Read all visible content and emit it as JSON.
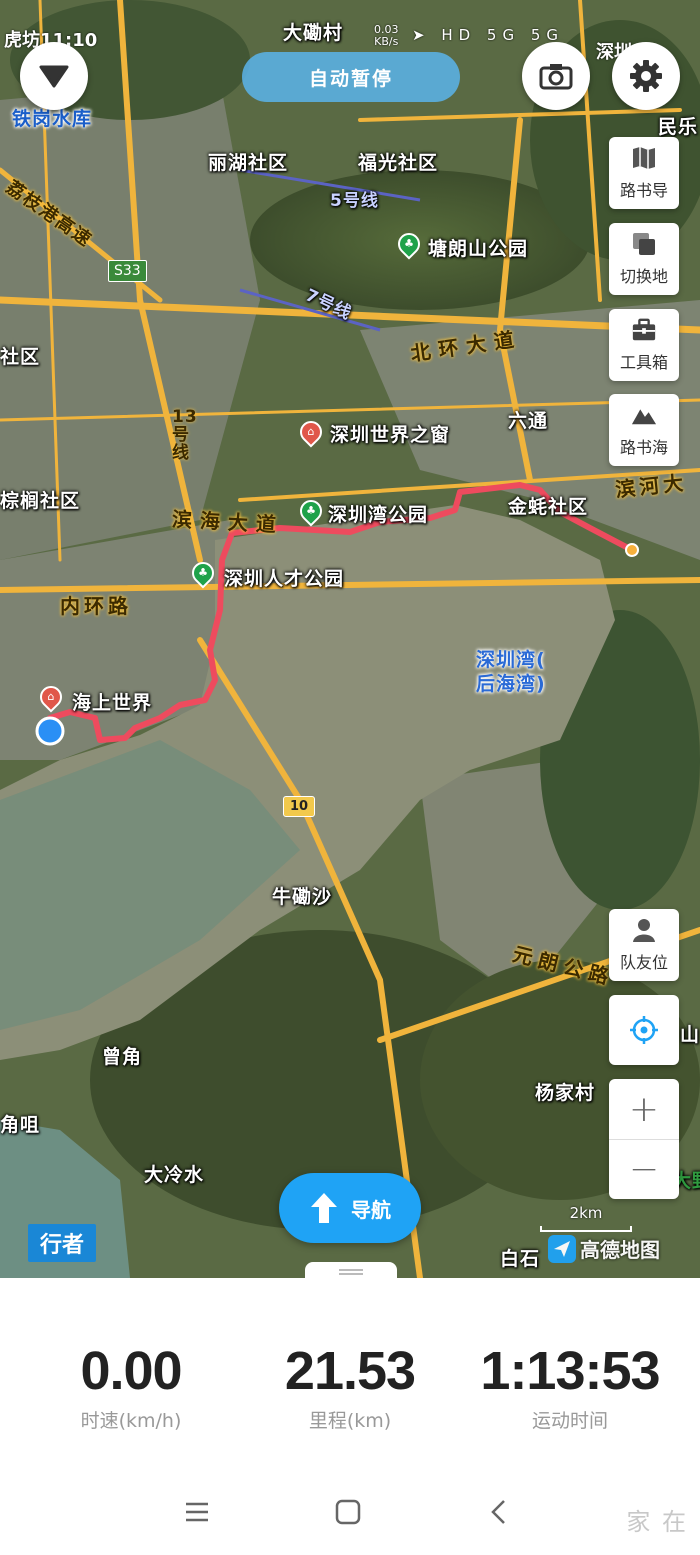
{
  "status_bar": {
    "time": "虎坊11:10",
    "net_speed_value": "0.03",
    "net_speed_unit": "KB/s",
    "icons": "➤ HD 5G 5G",
    "location_text": "深圳"
  },
  "top_controls": {
    "auto_pause_label": "自动暂停",
    "collapse_icon": "triangle-down-icon",
    "camera_icon": "camera-icon",
    "settings_icon": "gear-icon"
  },
  "side_panel": [
    {
      "label": "路书导",
      "icon": "map-icon"
    },
    {
      "label": "切换地",
      "icon": "layers-icon"
    },
    {
      "label": "工具箱",
      "icon": "toolbox-icon"
    },
    {
      "label": "路书海",
      "icon": "mountain-icon"
    }
  ],
  "side_lower": {
    "teammate_label": "队友位",
    "locate_icon": "locate-icon",
    "zoom_in": "+",
    "zoom_out": "−"
  },
  "map": {
    "labels": {
      "l1": "铁岗水库",
      "l2": "大磡村",
      "l3": "丽湖社区",
      "l4": "福光社区",
      "l5": "5号线",
      "l6": "塘朗山公园",
      "l7": "S33",
      "l8": "7号线",
      "l9": "北环大道",
      "l10": "社区",
      "l11": "六通",
      "l12": "深圳世界之窗",
      "l13": "13号线",
      "l14": "棕榈社区",
      "l15": "滨海大道",
      "l16": "深圳湾公园",
      "l17": "金蚝社区",
      "l18": "滨河大",
      "l19": "深圳人才公园",
      "l20": "内环路",
      "l21": "深圳湾(",
      "l22": "后海湾)",
      "l23": "海上世界",
      "l24": "10",
      "l25": "牛磡沙",
      "l26": "元朗公路",
      "l27": "曾角",
      "l28": "杨家村",
      "l29": "大冷水",
      "l30": "白石",
      "l31": "民乐",
      "l32": "荔枝港高速",
      "l33": "山",
      "l34": "大野",
      "l35": "角咀"
    },
    "scale_label": "2km",
    "map_provider": "高德地图",
    "walker_badge": "行者"
  },
  "nav_button": {
    "label": "导航",
    "icon": "arrow-up-icon"
  },
  "stats": [
    {
      "value": "0.00",
      "label": "时速(km/h)"
    },
    {
      "value": "21.53",
      "label": "里程(km)"
    },
    {
      "value": "1:13:53",
      "label": "运动时间"
    }
  ],
  "system_nav": {
    "menu_icon": "menu-icon",
    "home_icon": "home-square-icon",
    "back_icon": "back-chevron-icon",
    "watermark": "家 在"
  },
  "colors": {
    "route": "#ee4b5e",
    "pill": "#5ab4eb",
    "nav_button": "#1fa3f5",
    "road": "#f0b43c"
  }
}
